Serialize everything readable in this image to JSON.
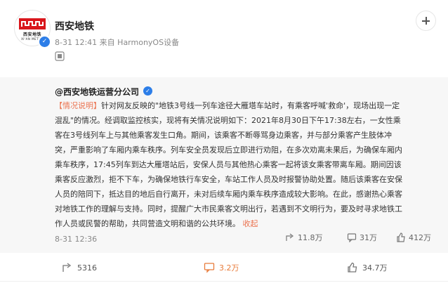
{
  "post": {
    "author": "西安地铁",
    "time": "8-31 12:41",
    "source": "来自 HarmonyOS设备",
    "logo_text": "西安地铁",
    "logo_sub": "XI'AN METRO"
  },
  "repost": {
    "author": "@西安地铁运营分公司",
    "hashtag": "【情况说明】",
    "text": "针对网友反映的\"地铁3号线一列车途径大雁塔车站时，有乘客呼喊'救命'，现场出现一定\n混乱\"的情况。经调取监控核实，现将有关情况说明如下：2021年8月30日下午17:38左右，一女性乘\n客在3号线列车上与其他乘客发生口角。期间，该乘客不断辱骂身边乘客，并与部分乘客产生肢体冲\n突，严重影响了车厢内乘车秩序。列车安全员发现后立即进行劝阻，在多次劝离未果后，为确保车厢内\n乘车秩序，17:45列车到达大雁塔站后，安保人员与其他热心乘客一起将该女乘客带离车厢。期间因该\n乘客反应激烈，拒不下车，为确保地铁行车安全，车站工作人员及时报警协助处置。随后该乘客在安保\n人员的陪同下，抵达目的地后自行离开，未对后续车厢内乘车秩序造成较大影响。在此，感谢热心乘客\n对地铁工作的理解与支持。同时，提醒广大市民乘客文明出行，若遇到不文明行为，要及时寻求地铁工\n作人员或民警的帮助，共同营造文明和谐的公共环境。 ",
    "collapse": "收起",
    "time": "8-31 12:36",
    "shares": "11.8万",
    "comments": "31万",
    "likes": "412万"
  },
  "actions": {
    "share": "5316",
    "comment": "3.2万",
    "like": "34.7万"
  },
  "colors": {
    "accent": "#eb7350",
    "verified": "#2d7ee8",
    "logo_red": "#d9161c"
  },
  "icons": [
    "follow-plus-icon",
    "verified-icon",
    "share-icon",
    "comment-icon",
    "like-icon"
  ]
}
